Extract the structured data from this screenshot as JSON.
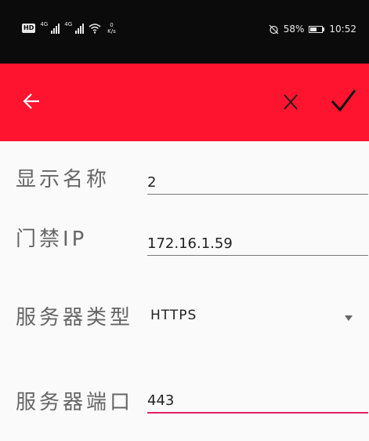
{
  "status_bar": {
    "hd_badge": "HD",
    "net1": "4G",
    "net2": "4G",
    "speed_value": "0",
    "speed_unit": "K/s",
    "battery_percent": "58%",
    "battery_level": 0.58,
    "time": "10:52"
  },
  "toolbar": {
    "back_icon": "arrow-left-icon",
    "close_icon": "close-icon",
    "confirm_icon": "checkmark-icon",
    "background_color": "#ff1430"
  },
  "form": {
    "display_name": {
      "label": "显示名称",
      "value": "2"
    },
    "door_ip": {
      "label": "门禁IP",
      "value": "172.16.1.59"
    },
    "server_type": {
      "label": "服务器类型",
      "value": "HTTPS",
      "icon": "dropdown-arrow-icon"
    },
    "server_port": {
      "label": "服务器端口",
      "value": "443"
    }
  }
}
